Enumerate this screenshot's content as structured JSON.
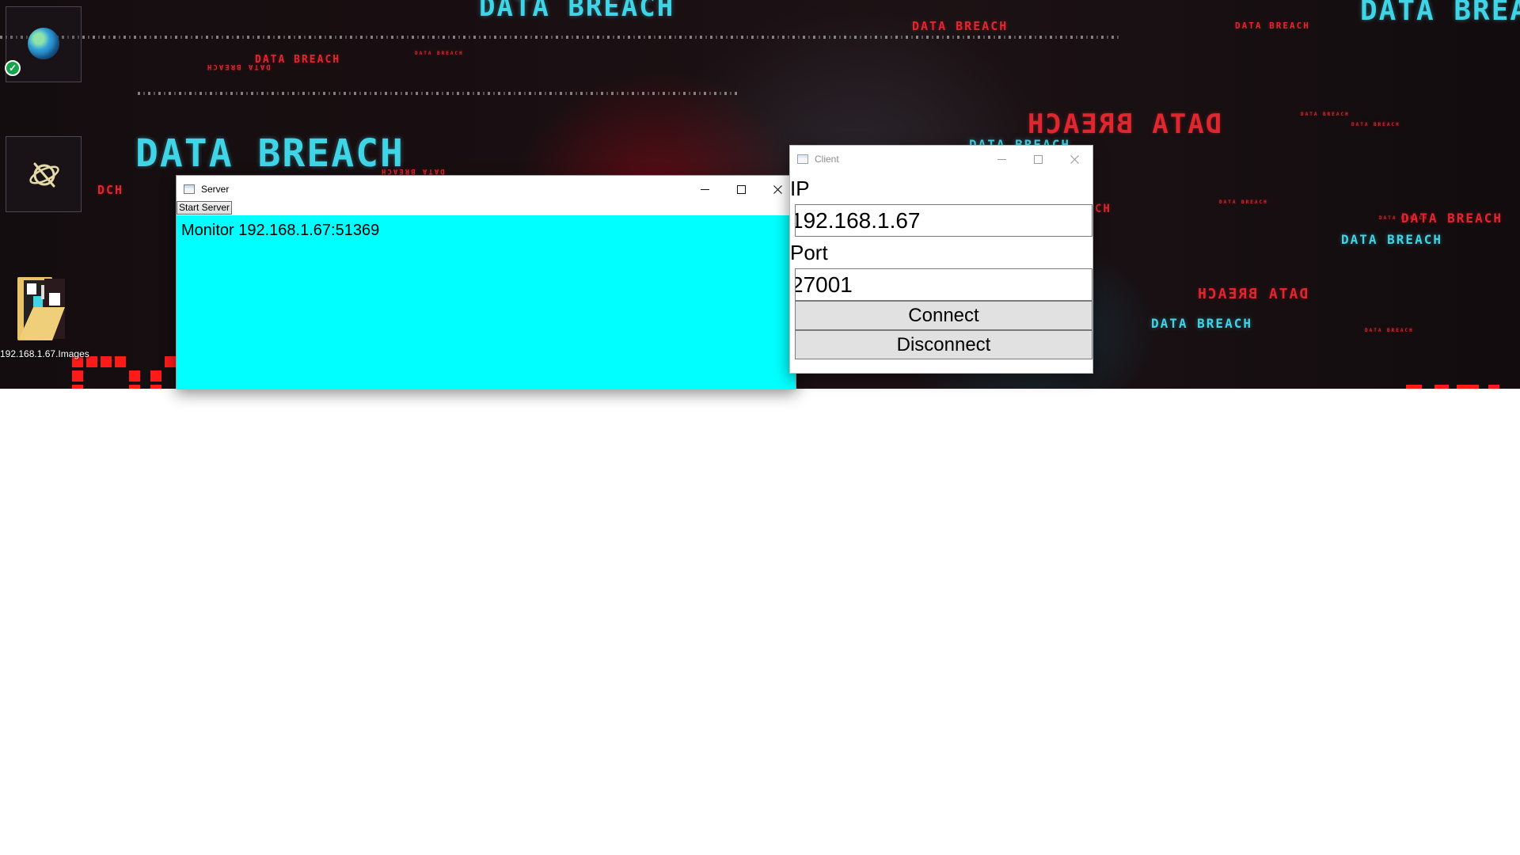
{
  "desktop": {
    "wallpaper_text": "DATA BREACH",
    "wallpaper_text_mirrored": "DATA BREACH",
    "wallpaper_text_partial": "DATA BREA",
    "wallpaper_text_fragment": "DCH",
    "wallpaper_text_fragment_2": "CH",
    "icons": {
      "browser": "globe-icon",
      "sync_badge": "check-badge-icon",
      "app2": "planet-slash-icon",
      "folder_label": "192.168.1.67.Images"
    },
    "colors": {
      "cyan": "#3fd4e6",
      "red": "#e0262f"
    }
  },
  "server_window": {
    "title": "Server",
    "start_button": "Start Server",
    "monitor_entries": [
      "Monitor 192.168.1.67:51369"
    ],
    "monitor_bg": "#00ffff"
  },
  "client_window": {
    "title": "Client",
    "ip_label": "IP",
    "ip_value": "192.168.1.67",
    "port_label": "Port",
    "port_value": "27001",
    "connect_button": "Connect",
    "disconnect_button": "Disconnect"
  }
}
